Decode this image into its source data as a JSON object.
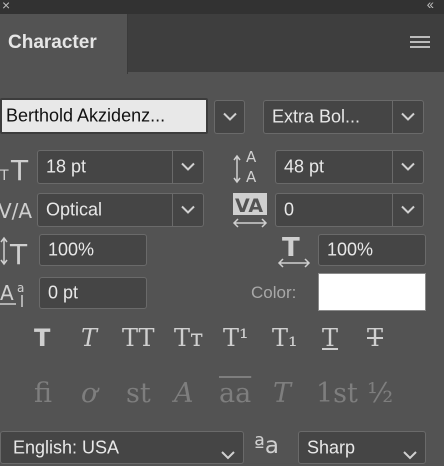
{
  "panel": {
    "title": "Character",
    "close_glyph": "×",
    "collapse_glyph": "‹‹",
    "menu_icon": "panel-menu-icon"
  },
  "font": {
    "family": "Berthold Akzidenz...",
    "style": "Extra Bol..."
  },
  "metrics": {
    "size": "18 pt",
    "leading": "48 pt",
    "kerning": "Optical",
    "tracking": "0",
    "vertical_scale": "100%",
    "horizontal_scale": "100%",
    "baseline_shift": "0 pt",
    "color_label": "Color:",
    "color_value": "#ffffff"
  },
  "style_buttons": [
    "T",
    "T",
    "TT",
    "Tт",
    "T¹",
    "T₁",
    "T",
    "T"
  ],
  "opentype_buttons": [
    "ﬁ",
    "ơ",
    "st",
    "A",
    "aa",
    "T",
    "1st",
    "½"
  ],
  "bottom": {
    "language": "English: USA",
    "aa_glyph": "ªa",
    "antialias": "Sharp"
  }
}
